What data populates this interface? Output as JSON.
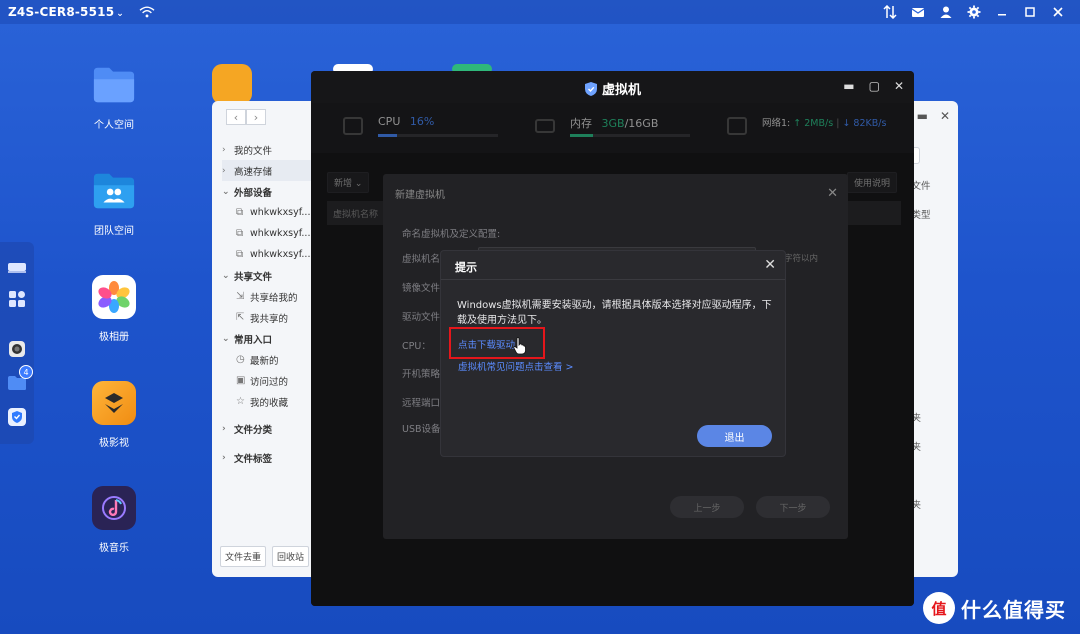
{
  "topbar": {
    "device_name": "Z4S-CER8-5515",
    "icons": [
      "wifi-icon",
      "transfer-icon",
      "mail-icon",
      "user-icon",
      "gear-icon",
      "minimize-icon",
      "maximize-icon",
      "close-icon"
    ]
  },
  "desktop": {
    "icons": [
      {
        "name": "personal-space",
        "label": "个人空间",
        "icon": "folder-icon",
        "color": "#4f8cf5"
      },
      {
        "name": "team-space",
        "label": "团队空间",
        "icon": "team-folder-icon",
        "color": "#2b96e8"
      },
      {
        "name": "photo-album",
        "label": "极相册",
        "icon": "flower-icon",
        "color": "#ffffff"
      },
      {
        "name": "video-app",
        "label": "极影视",
        "icon": "film-icon",
        "color": "#f5a623"
      },
      {
        "name": "music-app",
        "label": "极音乐",
        "icon": "music-note-icon",
        "color": "#3a2d7a"
      }
    ]
  },
  "dock": {
    "folder_badge": "4"
  },
  "file_manager": {
    "nav_back": "‹",
    "nav_forward": "›",
    "sidebar": [
      {
        "type": "item",
        "label": "我的文件"
      },
      {
        "type": "item",
        "label": "高速存储",
        "active": true
      },
      {
        "type": "group",
        "label": "外部设备"
      },
      {
        "type": "sub",
        "label": "whkwkxsyf..."
      },
      {
        "type": "sub",
        "label": "whkwkxsyf..."
      },
      {
        "type": "sub",
        "label": "whkwkxsyf..."
      },
      {
        "type": "group",
        "label": "共享文件"
      },
      {
        "type": "sub",
        "label": "共享给我的"
      },
      {
        "type": "sub",
        "label": "我共享的"
      },
      {
        "type": "group",
        "label": "常用入口"
      },
      {
        "type": "sub",
        "label": "最新的"
      },
      {
        "type": "sub",
        "label": "访问过的"
      },
      {
        "type": "sub",
        "label": "我的收藏"
      },
      {
        "type": "item",
        "label": "文件分类"
      },
      {
        "type": "item",
        "label": "文件标签"
      }
    ],
    "bottom_buttons": [
      "文件去重",
      "回收站"
    ],
    "right_column": [
      "",
      "交文件",
      "件类型",
      "",
      "",
      "",
      "",
      "件",
      "",
      "件夹",
      "件夹",
      "",
      "件夹"
    ]
  },
  "vm_window": {
    "title": "虚拟机",
    "cpu_label": "CPU",
    "cpu_value": "16%",
    "cpu_fill": 0.16,
    "mem_label": "内存",
    "mem_used": "3GB",
    "mem_sep": "/",
    "mem_total": "16GB",
    "mem_fill": 0.19,
    "net_label": "网络1:",
    "net_up": "↑ 2MB/s",
    "net_sep": "|",
    "net_down": "↓ 82KB/s",
    "new_button": "新增",
    "help_button": "使用说明",
    "table_col": "虚拟机名称"
  },
  "new_vm_modal": {
    "title": "新建虚拟机",
    "section": "命名虚拟机及定义配置:",
    "labels": [
      "虚拟机名",
      "镜像文件",
      "驱动文件",
      "CPU：",
      "开机策略",
      "远程端口",
      "USB设备"
    ],
    "hint": "字符以内",
    "prev_button": "上一步",
    "next_button": "下一步"
  },
  "dialog": {
    "title": "提示",
    "message": "Windows虚拟机需要安装驱动，请根据具体版本选择对应驱动程序，下载及使用方法见下。",
    "download_link": "点击下载驱动",
    "faq_link": "虚拟机常见问题点击查看 >",
    "exit_button": "退出"
  },
  "watermark": {
    "text": "什么值得买",
    "logo": "值"
  }
}
